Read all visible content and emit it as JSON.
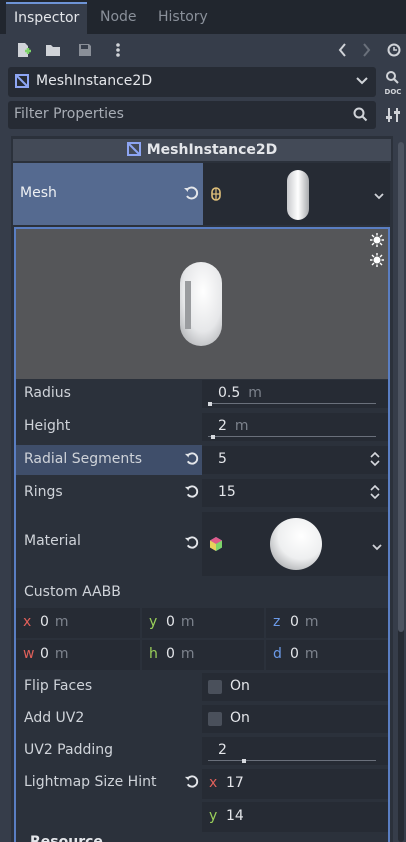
{
  "tabs": [
    {
      "label": "Inspector",
      "active": true
    },
    {
      "label": "Node",
      "active": false
    },
    {
      "label": "History",
      "active": false
    }
  ],
  "toolbar": {
    "icons": [
      "new-resource-icon",
      "load-resource-icon",
      "save-icon",
      "more-icon",
      "back-icon",
      "forward-icon",
      "history-icon"
    ]
  },
  "object_selector": {
    "value": "MeshInstance2D",
    "doc_label": "DOC"
  },
  "filter": {
    "placeholder": "Filter Properties"
  },
  "section_title": "MeshInstance2D",
  "mesh": {
    "label": "Mesh"
  },
  "properties": {
    "radius": {
      "label": "Radius",
      "value": "0.5",
      "unit": "m",
      "fraction": 0.0
    },
    "height": {
      "label": "Height",
      "value": "2",
      "unit": "m",
      "fraction": 0.02
    },
    "radial_segments": {
      "label": "Radial Segments",
      "value": "5"
    },
    "rings": {
      "label": "Rings",
      "value": "15"
    },
    "material": {
      "label": "Material"
    },
    "custom_aabb": {
      "label": "Custom AABB",
      "fields": [
        {
          "axis": "x",
          "value": "0",
          "unit": "m",
          "color": "#e0605a"
        },
        {
          "axis": "y",
          "value": "0",
          "unit": "m",
          "color": "#9ad05a"
        },
        {
          "axis": "z",
          "value": "0",
          "unit": "m",
          "color": "#6b9ae8"
        },
        {
          "axis": "w",
          "value": "0",
          "unit": "m",
          "color": "#e0605a"
        },
        {
          "axis": "h",
          "value": "0",
          "unit": "m",
          "color": "#9ad05a"
        },
        {
          "axis": "d",
          "value": "0",
          "unit": "m",
          "color": "#6b9ae8"
        }
      ]
    },
    "flip_faces": {
      "label": "Flip Faces",
      "toggle": "On"
    },
    "add_uv2": {
      "label": "Add UV2",
      "toggle": "On"
    },
    "uv2_padding": {
      "label": "UV2 Padding",
      "value": "2",
      "fraction": 0.2
    },
    "lightmap_size_hint": {
      "label": "Lightmap Size Hint",
      "x_axis": "x",
      "x": "17",
      "y_axis": "y",
      "y": "14"
    }
  },
  "resource_label": "Resource",
  "colors": {
    "accent": "#5a7ec2",
    "highlight": "#556a90"
  }
}
